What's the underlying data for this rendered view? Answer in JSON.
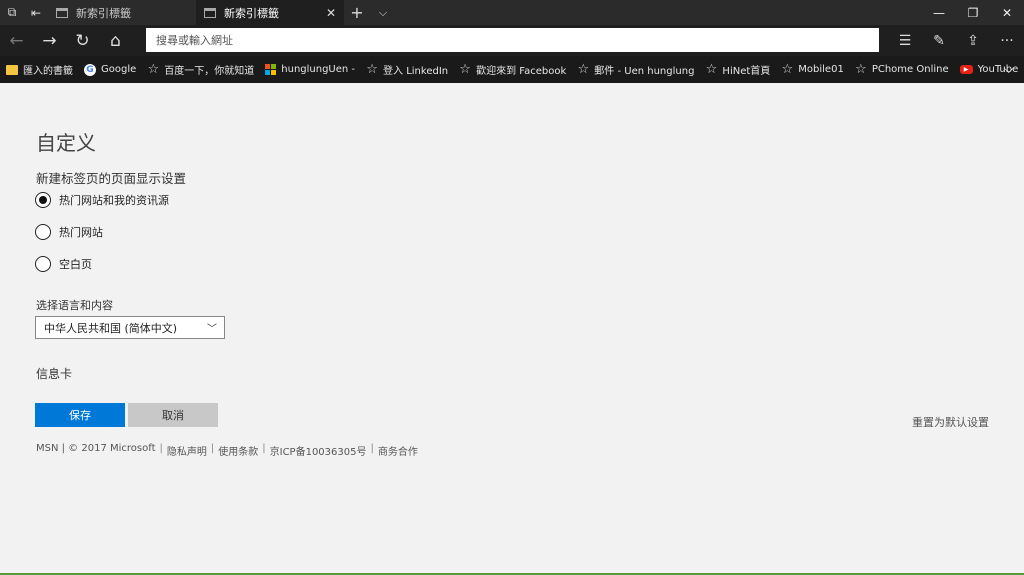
{
  "tabs": [
    {
      "title": "新索引標籤",
      "active": false
    },
    {
      "title": "新索引標籤",
      "active": true
    }
  ],
  "address": {
    "placeholder": "搜尋或輸入網址"
  },
  "favorites": [
    {
      "label": "匯入的書籤",
      "icon": "folder-icon"
    },
    {
      "label": "Google",
      "icon": "google-icon"
    },
    {
      "label": "百度一下，你就知道",
      "icon": "star-icon"
    },
    {
      "label": "hunglungUen -",
      "icon": "microsoft-icon"
    },
    {
      "label": "登入 LinkedIn",
      "icon": "star-icon"
    },
    {
      "label": "歡迎來到 Facebook",
      "icon": "star-icon"
    },
    {
      "label": "郵件 - Uen hunglung",
      "icon": "star-icon"
    },
    {
      "label": "HiNet首頁",
      "icon": "star-icon"
    },
    {
      "label": "Mobile01",
      "icon": "star-icon"
    },
    {
      "label": "PChome Online",
      "icon": "star-icon"
    },
    {
      "label": "YouTube",
      "icon": "youtube-icon"
    }
  ],
  "page": {
    "title": "自定义",
    "section_label": "新建标签页的页面显示设置",
    "options": [
      {
        "label": "热门网站和我的资讯源",
        "selected": true
      },
      {
        "label": "热门网站",
        "selected": false
      },
      {
        "label": "空白页",
        "selected": false
      }
    ],
    "language_label": "选择语言和内容",
    "language_value": "中华人民共和国 (简体中文)",
    "info_card": "信息卡",
    "save": "保存",
    "cancel": "取消",
    "reset": "重置为默认设置"
  },
  "footer": {
    "items": [
      "MSN | © 2017 Microsoft",
      "隐私声明",
      "使用条款",
      "京ICP备10036305号",
      "商务合作"
    ]
  },
  "colors": {
    "accent": "#0078d7",
    "titlebar": "#2b2b2b"
  }
}
